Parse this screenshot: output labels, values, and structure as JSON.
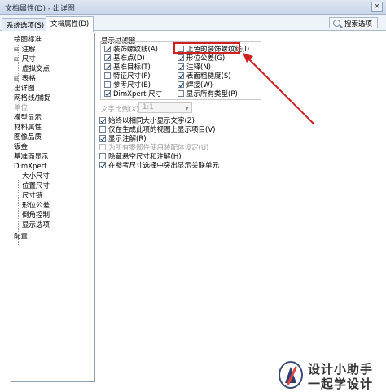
{
  "window": {
    "title": "文档属性(D) - 出详图",
    "close_label": "×"
  },
  "tabs": [
    {
      "label": "系统选项(S)"
    },
    {
      "label": "文档属性(D)"
    }
  ],
  "search": {
    "label": "搜索选项"
  },
  "tree": [
    {
      "label": "绘图标准"
    },
    {
      "label": "注解",
      "expander": "⊞"
    },
    {
      "label": "尺寸",
      "expander": "⊞"
    },
    {
      "label": "虚拟交点"
    },
    {
      "label": "表格",
      "expander": "⊞"
    },
    {
      "label": "出详图"
    },
    {
      "label": "网格线/捕捉"
    },
    {
      "label": "单位"
    },
    {
      "label": "模型显示"
    },
    {
      "label": "材料属性"
    },
    {
      "label": "图像品质"
    },
    {
      "label": "钣金"
    },
    {
      "label": "基准面显示"
    },
    {
      "label": "DimXpert"
    },
    {
      "label": "大小尺寸"
    },
    {
      "label": "位置尺寸"
    },
    {
      "label": "尺寸链"
    },
    {
      "label": "形位公差"
    },
    {
      "label": "倒角控制"
    },
    {
      "label": "显示选项"
    },
    {
      "label": "配置"
    }
  ],
  "display_filter": {
    "label": "显示过滤器",
    "left": [
      {
        "label": "装饰螺纹线(A)",
        "checked": true
      },
      {
        "label": "基准点(D)",
        "checked": true
      },
      {
        "label": "基准目标(T)",
        "checked": true
      },
      {
        "label": "特征尺寸(F)",
        "checked": false
      },
      {
        "label": "参考尺寸(E)",
        "checked": false
      },
      {
        "label": "DimXpert 尺寸",
        "checked": true
      }
    ],
    "right": [
      {
        "label": "上色的装饰螺纹线(I)",
        "checked": false
      },
      {
        "label": "形位公差(G)",
        "checked": true
      },
      {
        "label": "注释(N)",
        "checked": true
      },
      {
        "label": "表面粗糙度(S)",
        "checked": true
      },
      {
        "label": "焊接(W)",
        "checked": true
      },
      {
        "label": "显示所有类型(P)",
        "checked": false
      }
    ]
  },
  "text_scale": {
    "label": "文字比例(X):",
    "value": "1:1"
  },
  "options": [
    {
      "label": "始终以相同大小显示文字(Z)",
      "checked": true,
      "disabled": false
    },
    {
      "label": "仅在生成此项的视图上显示项目(V)",
      "checked": false,
      "disabled": false
    },
    {
      "label": "显示注解(R)",
      "checked": true,
      "disabled": false
    },
    {
      "label": "为所有零部件使用装配体设定(U)",
      "checked": false,
      "disabled": true
    },
    {
      "label": "隐藏悬空尺寸和注解(H)",
      "checked": false,
      "disabled": false
    },
    {
      "label": "在参考尺寸选择中突出显示关联单元",
      "checked": true,
      "disabled": false
    }
  ],
  "watermark": {
    "line1": "设计小助手",
    "line2": "一起学设计"
  },
  "colors": {
    "highlight": "#d02020",
    "accent": "#1a3a6a"
  }
}
